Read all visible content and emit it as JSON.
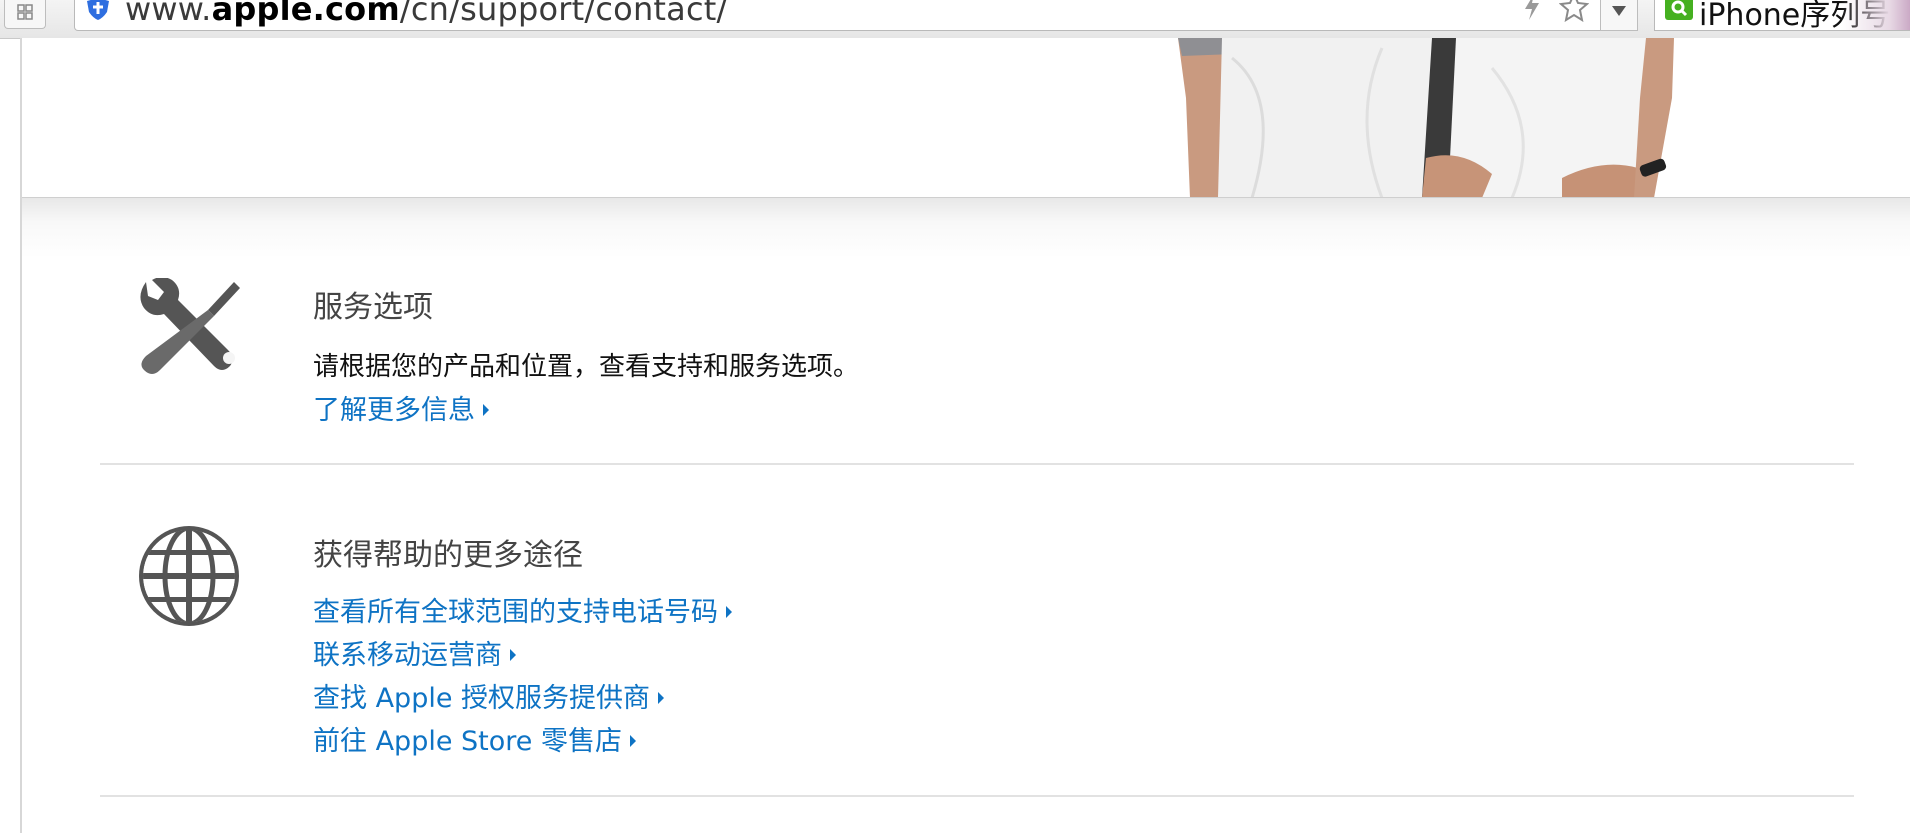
{
  "browser": {
    "url_prefix": "www.",
    "url_domain": "apple.com",
    "url_path": "/cn/support/contact/",
    "search_text": "iPhone序列号查"
  },
  "sections": [
    {
      "icon": "tools-icon",
      "title": "服务选项",
      "description": "请根据您的产品和位置，查看支持和服务选项。",
      "links": [
        "了解更多信息"
      ]
    },
    {
      "icon": "globe-icon",
      "title": "获得帮助的更多途径",
      "links": [
        "查看所有全球范围的支持电话号码",
        "联系移动运营商",
        "查找 Apple 授权服务提供商",
        "前往 Apple Store 零售店"
      ]
    }
  ],
  "colors": {
    "link": "#0e73c4",
    "title": "#444444",
    "icon": "#555555"
  }
}
